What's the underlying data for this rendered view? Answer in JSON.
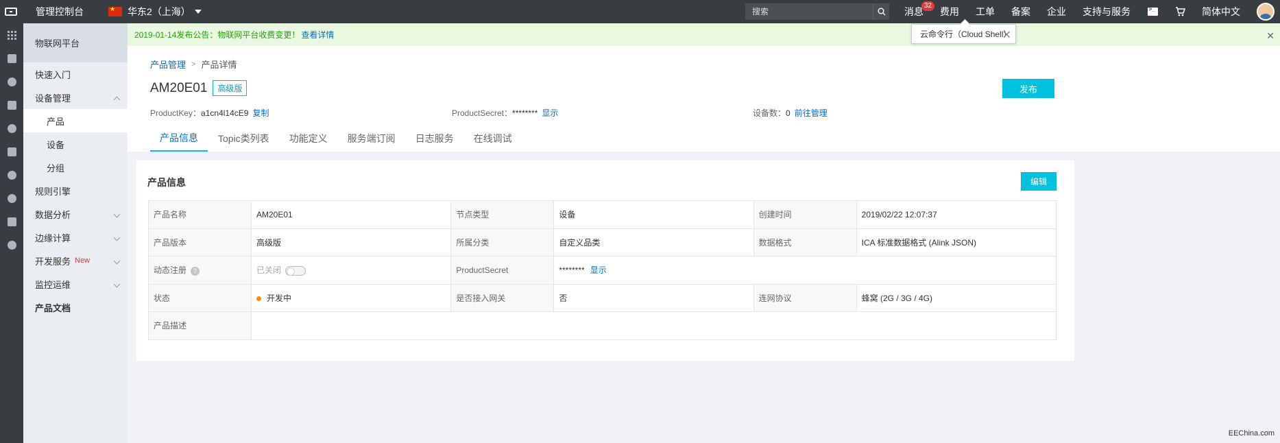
{
  "topbar": {
    "console_label": "管理控制台",
    "region_label": "华东2（上海）",
    "search_placeholder": "搜索",
    "messages_label": "消息",
    "messages_count": "32",
    "nav": [
      "费用",
      "工单",
      "备案",
      "企业",
      "支持与服务"
    ],
    "language_label": "简体中文"
  },
  "sidebar": {
    "header": "物联网平台",
    "items": [
      {
        "label": "快速入门"
      },
      {
        "label": "设备管理"
      },
      {
        "label": "产品"
      },
      {
        "label": "设备"
      },
      {
        "label": "分组"
      },
      {
        "label": "规则引擎"
      },
      {
        "label": "数据分析"
      },
      {
        "label": "边缘计算"
      },
      {
        "label": "开发服务",
        "tag": "New"
      },
      {
        "label": "监控运维"
      },
      {
        "label": "产品文档"
      }
    ]
  },
  "notice": {
    "text": "2019-01-14发布公告：物联网平台收费变更！",
    "link": "查看详情"
  },
  "tooltip": {
    "text": "云命令行（Cloud Shell）"
  },
  "breadcrumb": {
    "parent": "产品管理",
    "current": "产品详情"
  },
  "product": {
    "name": "AM20E01",
    "edition": "高级版",
    "publish_label": "发布",
    "key_label": "ProductKey：",
    "key_value": "a1cn4l14cE9",
    "copy_label": "复制",
    "secret_label": "ProductSecret：",
    "secret_value": "********",
    "show_label": "显示",
    "devices_label": "设备数：",
    "devices_value": "0",
    "manage_label": "前往管理"
  },
  "tabs": [
    "产品信息",
    "Topic类列表",
    "功能定义",
    "服务端订阅",
    "日志服务",
    "在线调试"
  ],
  "info": {
    "title": "产品信息",
    "edit_label": "编辑",
    "rows": [
      {
        "k1": "产品名称",
        "v1": "AM20E01",
        "k2": "节点类型",
        "v2": "设备",
        "k3": "创建时间",
        "v3": "2019/02/22 12:07:37"
      },
      {
        "k1": "产品版本",
        "v1": "高级版",
        "k2": "所属分类",
        "v2": "自定义品类",
        "k3": "数据格式",
        "v3": "ICA 标准数据格式 (Alink JSON)"
      },
      {
        "k1": "动态注册",
        "v1": "已关闭",
        "k2": "ProductSecret",
        "v2": "********",
        "v2_link": "显示"
      },
      {
        "k1": "状态",
        "v1": "开发中",
        "k2": "是否接入网关",
        "v2": "否",
        "k3": "连网协议",
        "v3": "蜂窝 (2G / 3G / 4G)"
      },
      {
        "k1": "产品描述",
        "v1": ""
      }
    ]
  },
  "watermark": "EEChina.com",
  "colors": {
    "accent": "#00c1de",
    "link": "#0070cc",
    "topbar": "#373d41",
    "status_dot": "#f98e1f"
  }
}
